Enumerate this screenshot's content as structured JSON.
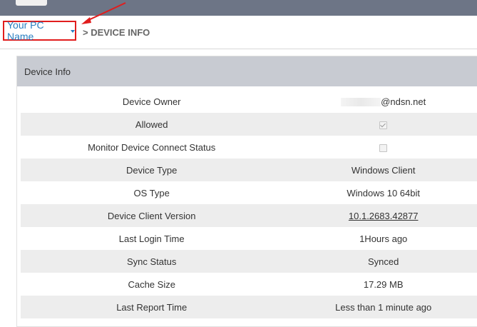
{
  "breadcrumb": {
    "pc_name": "Your PC Name",
    "separator_title": "> DEVICE INFO"
  },
  "panel": {
    "title": "Device Info",
    "rows": [
      {
        "label": "Device Owner",
        "value": "@ndsn.net"
      },
      {
        "label": "Allowed",
        "checked": true
      },
      {
        "label": "Monitor Device Connect Status",
        "checked": false
      },
      {
        "label": "Device Type",
        "value": "Windows Client"
      },
      {
        "label": "OS Type",
        "value": "Windows 10 64bit"
      },
      {
        "label": "Device Client Version",
        "value": "10.1.2683.42877"
      },
      {
        "label": "Last Login Time",
        "value": "1Hours ago"
      },
      {
        "label": "Sync Status",
        "value": "Synced"
      },
      {
        "label": "Cache Size",
        "value": "17.29 MB"
      },
      {
        "label": "Last Report Time",
        "value": "Less than 1 minute ago"
      }
    ]
  },
  "colors": {
    "topbar": "#6d7586",
    "highlight_border": "#e11d1d",
    "link": "#2a7fc1",
    "panel_header": "#c8cbd2",
    "stripe": "#ededed"
  }
}
